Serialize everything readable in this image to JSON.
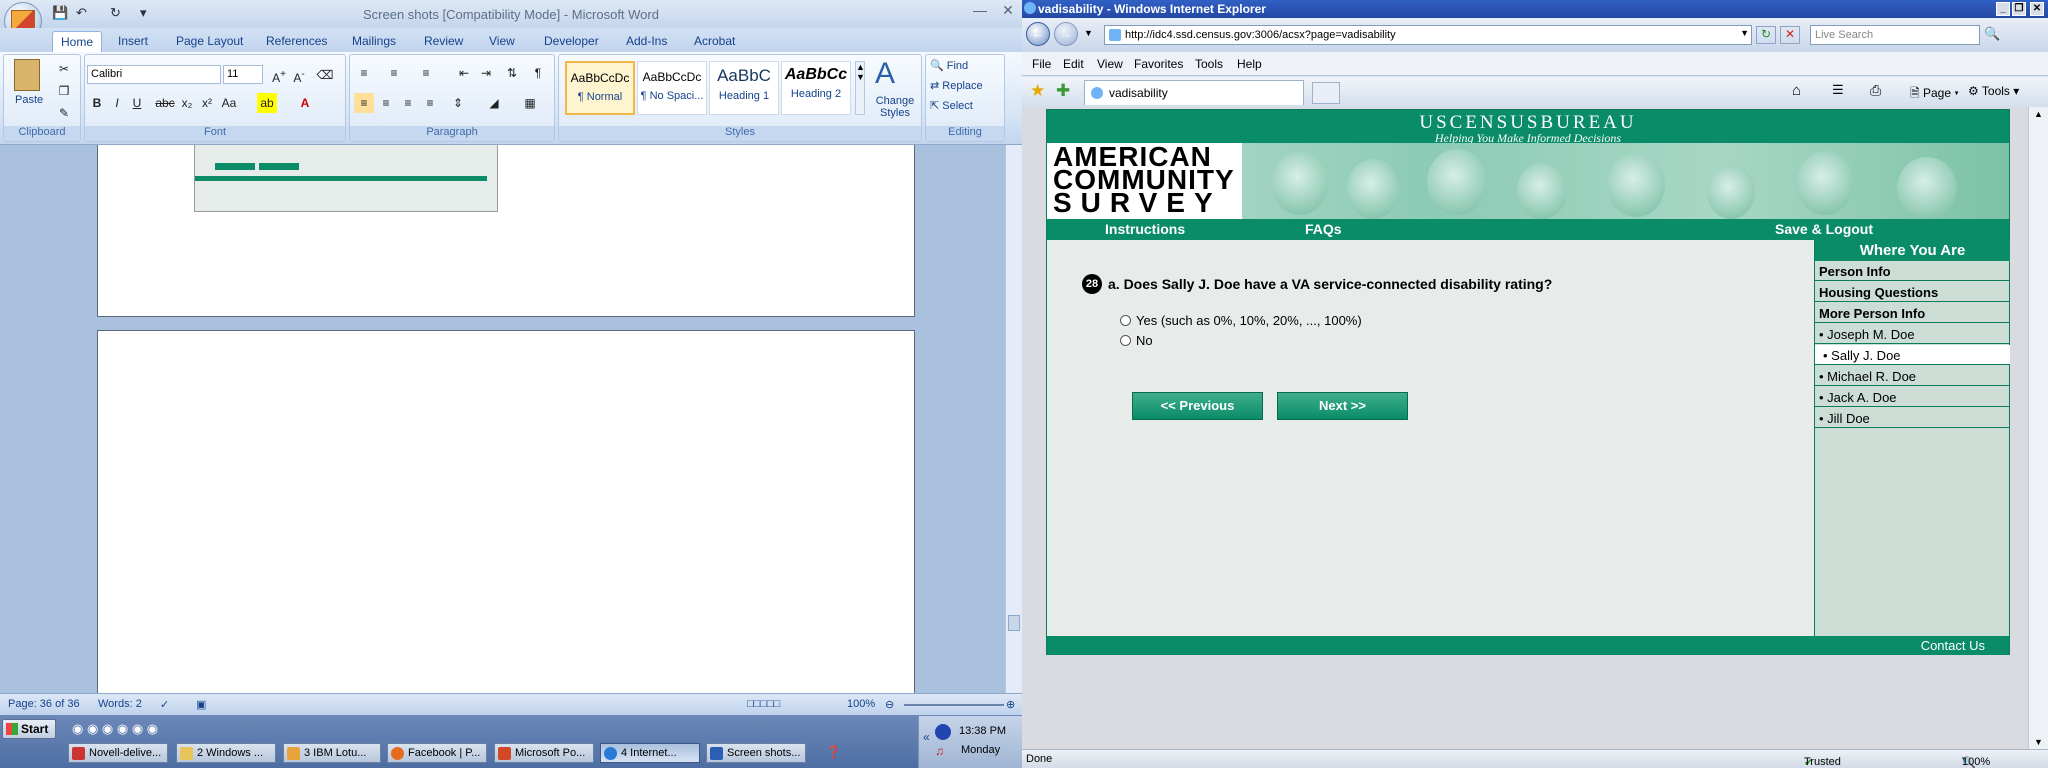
{
  "word": {
    "title": "Screen shots [Compatibility Mode] - Microsoft Word",
    "tabs": [
      "Home",
      "Insert",
      "Page Layout",
      "References",
      "Mailings",
      "Review",
      "View",
      "Developer",
      "Add-Ins",
      "Acrobat"
    ],
    "clipboard": {
      "paste": "Paste",
      "label": "Clipboard"
    },
    "font": {
      "name": "Calibri",
      "size": "11",
      "label": "Font"
    },
    "paragraph_label": "Paragraph",
    "styles": {
      "label": "Styles",
      "cards": [
        {
          "preview": "AaBbCcDc",
          "name": "¶ Normal"
        },
        {
          "preview": "AaBbCcDc",
          "name": "¶ No Spaci..."
        },
        {
          "preview": "AaBbC",
          "name": "Heading 1"
        },
        {
          "preview": "AaBbCc",
          "name": "Heading 2"
        }
      ],
      "change": "Change Styles"
    },
    "editing": {
      "find": "Find",
      "replace": "Replace",
      "select": "Select",
      "label": "Editing"
    },
    "status": {
      "page": "Page: 36 of 36",
      "words": "Words: 2",
      "zoom": "100%"
    }
  },
  "taskbar": {
    "start": "Start",
    "buttons": [
      "Novell-delive...",
      "2 Windows ...",
      "3 IBM Lotu...",
      "Facebook | P...",
      "Microsoft Po...",
      "4 Internet...",
      "Screen shots..."
    ],
    "time": "13:38 PM",
    "day": "Monday"
  },
  "ie": {
    "title": "vadisability - Windows Internet Explorer",
    "url": "http://idc4.ssd.census.gov:3006/acsx?page=vadisability",
    "search_placeholder": "Live Search",
    "menu": [
      "File",
      "Edit",
      "View",
      "Favorites",
      "Tools",
      "Help"
    ],
    "tab": "vadisability",
    "cmd": {
      "page": "Page",
      "tools": "Tools"
    },
    "status": {
      "left": "Done",
      "zone": "Trusted sites",
      "zoom": "100%"
    }
  },
  "census": {
    "brand": "USCENSUSBUREAU",
    "tagline": "Helping You Make Informed Decisions",
    "acs": [
      "AMERICAN",
      "COMMUNITY",
      "SURVEY"
    ],
    "nav": {
      "instructions": "Instructions",
      "faqs": "FAQs",
      "save": "Save & Logout"
    },
    "sidebar": {
      "title": "Where You Are",
      "items": [
        {
          "label": "Person Info",
          "bold": true
        },
        {
          "label": "Housing Questions",
          "bold": true
        },
        {
          "label": "More Person Info",
          "bold": true
        },
        {
          "label": "• Joseph M. Doe"
        },
        {
          "label": "• Sally J. Doe",
          "current": true
        },
        {
          "label": "• Michael R. Doe"
        },
        {
          "label": "• Jack A. Doe"
        },
        {
          "label": "• Jill Doe"
        }
      ]
    },
    "question": {
      "number": "28",
      "text": "a. Does Sally J. Doe have a VA service-connected disability rating?",
      "options": [
        "Yes (such as 0%, 10%, 20%, ..., 100%)",
        "No"
      ]
    },
    "buttons": {
      "previous": "<<  Previous",
      "next": "Next  >>"
    },
    "footer": "Contact Us"
  }
}
